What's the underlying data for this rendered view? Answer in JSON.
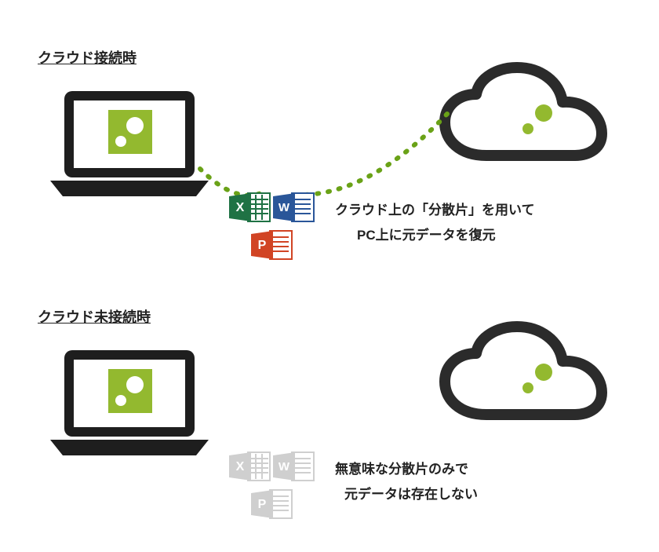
{
  "heading_connected": "クラウド接続時",
  "heading_disconnected": "クラウド未接続時",
  "caption_connected_line1": "クラウド上の「分散片」を用いて",
  "caption_connected_line2": "PC上に元データを復元",
  "caption_disconnected_line1": "無意味な分散片のみで",
  "caption_disconnected_line2": "元データは存在しない",
  "icons": {
    "laptop": "laptop",
    "cloud": "cloud",
    "excel": "excel-file-icon",
    "word": "word-file-icon",
    "powerpoint": "powerpoint-file-icon"
  },
  "colors": {
    "excel": "#1f7244",
    "word": "#2a5699",
    "powerpoint": "#d14424",
    "disabled": "#cfcfcf",
    "accent_green": "#93b92f",
    "stroke_dark": "#2b2b2b"
  }
}
